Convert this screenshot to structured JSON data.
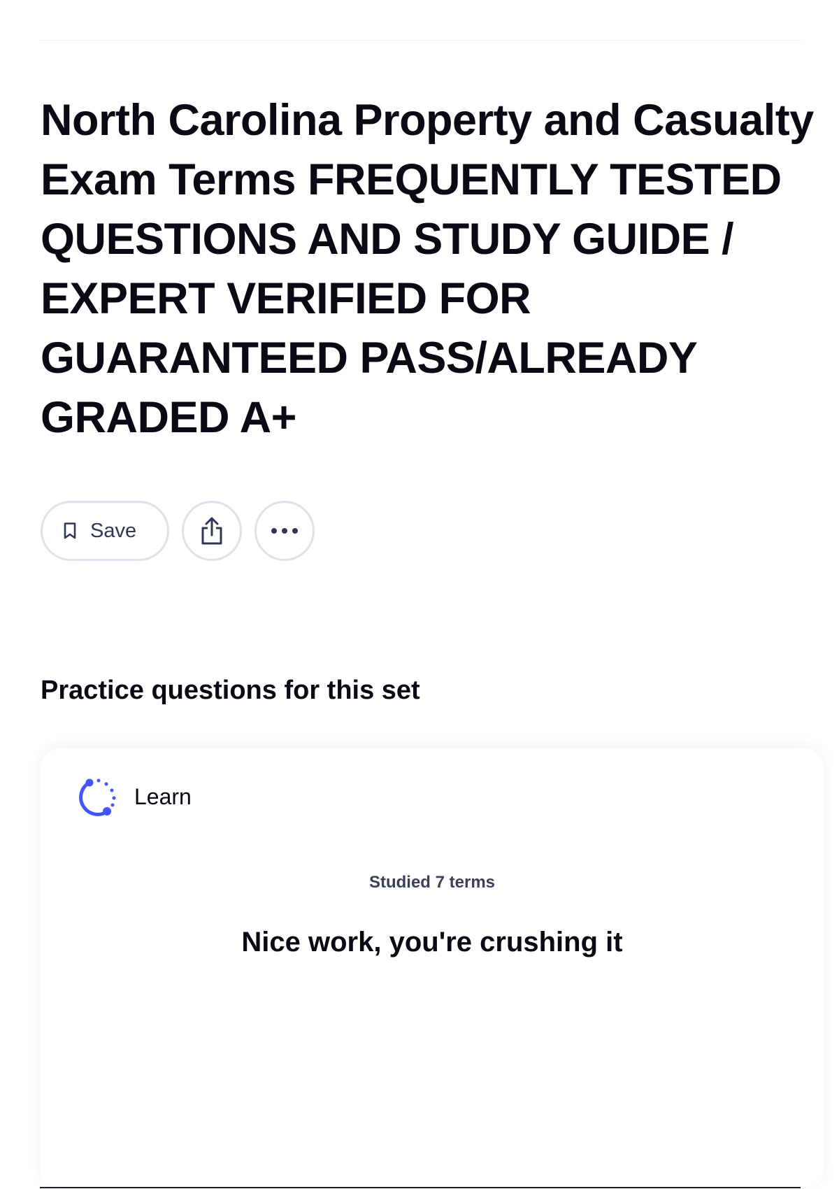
{
  "set": {
    "title": "North Carolina Property and Casualty Exam Terms FREQUENTLY TESTED QUESTIONS AND STUDY GUIDE  / EXPERT VERIFIED FOR GUARANTEED PASS/ALREADY GRADED A+"
  },
  "actions": {
    "save_label": "Save",
    "save_icon": "bookmark-icon",
    "share_icon": "share-icon",
    "more_icon": "more-horizontal-icon"
  },
  "practice": {
    "heading": "Practice questions for this set",
    "card": {
      "mode_label": "Learn",
      "mode_icon": "learn-progress-icon",
      "studied_text": "Studied 7 terms",
      "message": "Nice work, you're crushing it"
    }
  },
  "colors": {
    "text": "#0a0a14",
    "secondary_text": "#2e3856",
    "border": "#dfe2ea",
    "accent": "#4255ff"
  }
}
